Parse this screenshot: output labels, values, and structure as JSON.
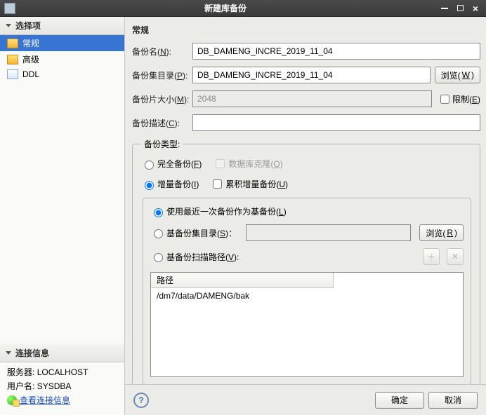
{
  "window": {
    "title": "新建库备份",
    "minimize": "minimize",
    "maximize": "maximize",
    "close": "close"
  },
  "sidebar": {
    "select_header": "选择项",
    "items": [
      {
        "label": "常规"
      },
      {
        "label": "高级"
      },
      {
        "label": "DDL"
      }
    ],
    "conn_header": "连接信息",
    "server_label": "服务器:",
    "server_value": "LOCALHOST",
    "user_label": "用户名:",
    "user_value": "SYSDBA",
    "conn_link": "查看连接信息"
  },
  "main": {
    "heading": "常规",
    "backup_name_label": "备份名(",
    "backup_name_key": "N",
    "backup_name_label_end": "):",
    "backup_name_value": "DB_DAMENG_INCRE_2019_11_04",
    "backup_dir_label": "备份集目录(",
    "backup_dir_key": "P",
    "backup_dir_label_end": "):",
    "backup_dir_value": "DB_DAMENG_INCRE_2019_11_04",
    "browse_w": "浏览(",
    "browse_w_key": "W",
    "close_paren": ")",
    "piece_size_label": "备份片大小(",
    "piece_size_key": "M",
    "piece_size_label_end": "):",
    "piece_size_value": "2048",
    "limit_label": "限制(",
    "limit_key": "E",
    "desc_label": "备份描述(",
    "desc_key": "C",
    "desc_label_end": "):",
    "desc_value": "",
    "type_legend": "备份类型:",
    "full_label": "完全备份(",
    "full_key": "F",
    "db_clone_label": "数据库克隆(",
    "db_clone_key": "O",
    "incre_label": "增量备份(",
    "incre_key": "I",
    "cumul_label": "累积增量备份(",
    "cumul_key": "U",
    "use_last_label": "使用最近一次备份作为基备份(",
    "use_last_key": "L",
    "base_dir_label": "基备份集目录(",
    "base_dir_key": "S",
    "base_dir_end": ")：",
    "browse_r": "浏览(",
    "browse_r_key": "R",
    "scan_label": "基备份扫描路径(",
    "scan_key": "V",
    "scan_end": "):",
    "path_header": "路径",
    "path_row0": "/dm7/data/DAMENG/bak"
  },
  "footer": {
    "help": "?",
    "ok": "确定",
    "cancel": "取消"
  }
}
